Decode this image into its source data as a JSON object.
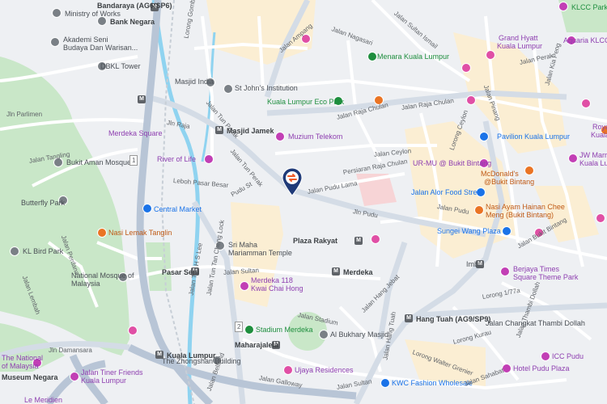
{
  "colors": {
    "background": "#eef0f3",
    "highway": "#b8c5d6",
    "road": "#ffffff",
    "park": "#c9e7c8",
    "commercial": "#fbeed3",
    "river": "#8fd3f0",
    "pin": "#1f3a78",
    "pin_accent": "#f05a28"
  },
  "pin": {
    "icon": "swap-arrows-icon"
  },
  "poi_labels": [
    "Bandaraya (AG6/SP6)",
    "Ministry of Works",
    "Bank Negara",
    "Akademi Seni",
    "Budaya Dan Warisan...",
    "DBKL Tower",
    "Masjid India",
    "St John's Institution",
    "Kuala Lumpur Eco Park",
    "Menara Kuala Lumpur",
    "Grand Hyatt",
    "Kuala Lumpur",
    "Aquaria KLCC",
    "KLCC Park",
    "Masjid Jamek",
    "Merdeka Square",
    "Muzium Telekom",
    "Bukit Aman Mosque",
    "River of Life",
    "UR-MU @ Bukit Bintang",
    "McDonald's",
    "@Bukit Bintang",
    "Jalan Alor Food Street",
    "Pavilion Kuala Lumpur",
    "JW Marriott",
    "Kuala Lumpur",
    "Royale",
    "Kuala Lumpur",
    "Butterfly Park",
    "KL Bird Park",
    "Nasi Lemak Tanglin",
    "Central Market",
    "Plaza Rakyat",
    "Nasi Ayam Hainan Chee",
    "Meng (Bukit Bintang)",
    "Sungei Wang Plaza",
    "Sri Maha",
    "Mariamman Temple",
    "National Mosque of",
    "Malaysia",
    "Pasar Seni",
    "Merdeka",
    "Merdeka 118",
    "Kwai Chai Hong",
    "Berjaya Times",
    "Square Theme Park",
    "Imbi",
    "Stadium Merdeka",
    "Al Bukhary Masjid",
    "Hang Tuah (AG9/SP9)",
    "Kuala Lumpur",
    "Maharajalela",
    "The Zhongshan Building",
    "Jalan Changkat Thambi Dollah",
    "ICC Pudu",
    "Hotel Pudu Plaza",
    "Ujaya Residences",
    "KWC Fashion Wholesale",
    "The National",
    "of Malaysia",
    "Jalan Tiner Friends",
    "Kuala Lumpur",
    "Le Meridien",
    "Museum Negara",
    "Jln Parlimen",
    "Jln Damansara"
  ],
  "road_labels": [
    "Jalan Sultan Ismail",
    "Jln Raja",
    "Jalan Raja Chulan",
    "Jalan Ampang",
    "Lorong Gombak",
    "Jalan Perak",
    "Jalan Kia Peng",
    "Jalan Pinang",
    "Jalan Tun Perak",
    "Jalan Raja Chulan",
    "Jalan Ceylon",
    "Lorong Ceylon",
    "Jalan Tun Perak",
    "Persiaran Raja Chulan",
    "Leboh Pasar Besar",
    "Pudu St",
    "Jalan Pudu Lama",
    "Jln Pudu",
    "Jalan Sultan",
    "Jalan Tun H S Lee",
    "Jalan Tun Tan Cheng Lock",
    "Jalan Hang Jebat",
    "Jalan Hang Tuah",
    "Jalan Stadium",
    "Jalan Bukit Bintang",
    "Jalan Perdana",
    "Jalan Lembah",
    "Jalan Tangling",
    "Jalan Bellfield",
    "Jalan Sultan",
    "Lorong 1/77a",
    "Jalan Nagasari",
    "Lorong Kurau",
    "Lorong Walter Grenier",
    "Jalan Thambi Dollah",
    "Jalan Sahabat",
    "Jalan Galloway",
    "Jalan Pudu"
  ],
  "metro_letter": "M",
  "route_numbers": [
    "1",
    "2"
  ]
}
